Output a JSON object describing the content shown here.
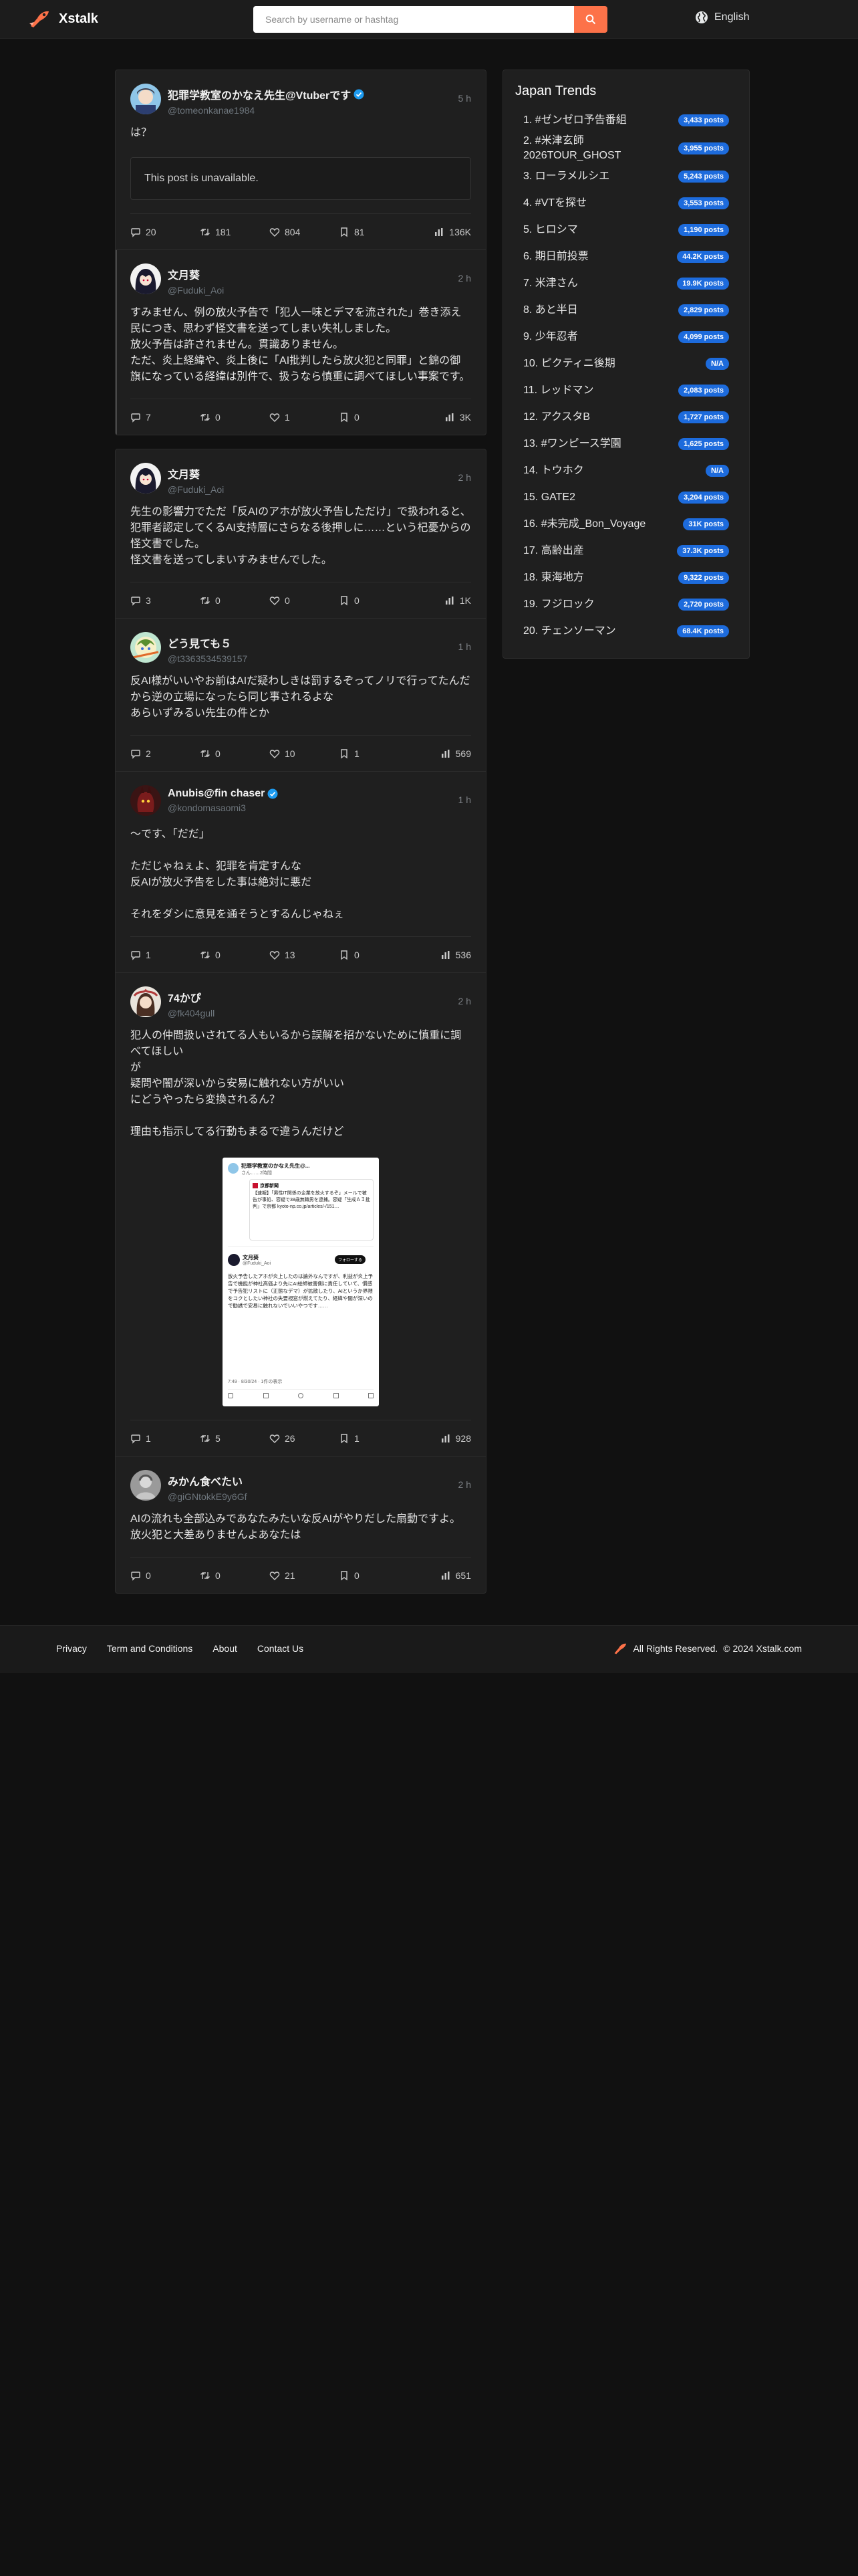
{
  "header": {
    "app_name": "Xstalk",
    "search_placeholder": "Search by username or hashtag",
    "language": "English",
    "brand_color": "#fd7249"
  },
  "posts": [
    {
      "display_name": "犯罪学教室のかなえ先生@Vtuberです",
      "username": "@tomeonkanae1984",
      "verified": true,
      "time": "5 h",
      "text": "は？",
      "unavailable": "This post is unavailable.",
      "stats": {
        "replies": "20",
        "reposts": "181",
        "likes": "804",
        "bookmarks": "81",
        "views": "136K"
      }
    },
    {
      "display_name": "文月葵",
      "username": "@Fuduki_Aoi",
      "verified": false,
      "time": "2 h",
      "text": "すみません、例の放火予告で「犯人一味とデマを流された」巻き添え民につき、思わず怪文書を送ってしまい失礼しました。\n放火予告は許されません。貫識ありません。\nただ、炎上経緯や、炎上後に「AI批判したら放火犯と同罪」と錦の御旗になっている経緯は別件で、扱うなら慎重に調べてほしい事案です。",
      "stats": {
        "replies": "7",
        "reposts": "0",
        "likes": "1",
        "bookmarks": "0",
        "views": "3K"
      }
    },
    {
      "display_name": "文月葵",
      "username": "@Fuduki_Aoi",
      "verified": false,
      "time": "2 h",
      "text": "先生の影響力でただ「反AIのアホが放火予告しただけ」で扱われると、犯罪者認定してくるAI支持層にさらなる後押しに……という杞憂からの怪文書でした。\n怪文書を送ってしまいすみませんでした。",
      "stats": {
        "replies": "3",
        "reposts": "0",
        "likes": "0",
        "bookmarks": "0",
        "views": "1K"
      }
    },
    {
      "display_name": "どう見ても５",
      "username": "@t3363534539157",
      "verified": false,
      "time": "1 h",
      "text": "反AI様がいいやお前はAIだ疑わしきは罰するぞってノリで行ってたんだから逆の立場になったら同じ事されるよな\nあらいずみるい先生の件とか",
      "stats": {
        "replies": "2",
        "reposts": "0",
        "likes": "10",
        "bookmarks": "1",
        "views": "569"
      }
    },
    {
      "display_name": "Anubis@fin chaser",
      "username": "@kondomasaomi3",
      "verified": true,
      "time": "1 h",
      "text": "〜です、「だだ」\n\nただじゃねぇよ、犯罪を肯定すんな\n反AIが放火予告をした事は絶対に悪だ\n\nそれをダシに意見を通そうとするんじゃねぇ",
      "stats": {
        "replies": "1",
        "reposts": "0",
        "likes": "13",
        "bookmarks": "0",
        "views": "536"
      }
    },
    {
      "display_name": "74かぴ",
      "username": "@fk404gull",
      "verified": false,
      "time": "2 h",
      "text": "犯人の仲間扱いされてる人もいるから誤解を招かないために慎重に調べてほしい\nが\n疑問や闇が深いから安易に触れない方がいい\nにどうやったら変換されるん？\n\n理由も指示してる行動もまるで違うんだけど",
      "embed": {
        "author": "犯罪学教室のかなえ先生@...",
        "handle": "さん……2時間",
        "quote_source": "京都新聞",
        "quote_text": "【速報】「男性IT関係の企業を放火するぞ」メールで被告が事処、容疑で38歳無職男を逮捕。容疑「生成ＡＩ批判」で京都 kyoto-np.co.jp/articles/-/151…",
        "reply_author": "文月葵",
        "reply_handle": "@Fuduki_Aoi",
        "follow_label": "フォローする",
        "reply_text": "放火予告したアホが炎上したのは論外なんですが、利益が炎上予告で機能が神社高価より先にAI絵師被害側に責任していて、慣感で予告犯リストに（正態なデマ）が拡散したり、AIというか界隈をコクとしたい神社の失要視窓が燃えてたり、経緯や闇が深いので勧誘で安易に触れないでいいやつです……",
        "footer_time": "7:49 · 8/30/24 · 1件の表示"
      },
      "stats": {
        "replies": "1",
        "reposts": "5",
        "likes": "26",
        "bookmarks": "1",
        "views": "928"
      }
    },
    {
      "display_name": "みかん食べたい",
      "username": "@giGNtokkE9y6Gf",
      "verified": false,
      "time": "2 h",
      "text": "AIの流れも全部込みであなたみたいな反AIがやりだした扇動ですよ。放火犯と大差ありませんよあなたは",
      "stats": {
        "replies": "0",
        "reposts": "0",
        "likes": "21",
        "bookmarks": "0",
        "views": "651"
      }
    }
  ],
  "trends": {
    "title": "Japan Trends",
    "items": [
      {
        "name": "1. #ゼンゼロ予告番組",
        "count": "3,433 posts"
      },
      {
        "name": "2. #米津玄師 2026TOUR_GHOST",
        "count": "3,955 posts"
      },
      {
        "name": "3. ローラメルシエ",
        "count": "5,243 posts"
      },
      {
        "name": "4. #VTを探せ",
        "count": "3,553 posts"
      },
      {
        "name": "5. ヒロシマ",
        "count": "1,190 posts"
      },
      {
        "name": "6. 期日前投票",
        "count": "44.2K posts"
      },
      {
        "name": "7. 米津さん",
        "count": "19.9K posts"
      },
      {
        "name": "8. あと半日",
        "count": "2,829 posts"
      },
      {
        "name": "9. 少年忍者",
        "count": "4,099 posts"
      },
      {
        "name": "10. ピクティニ後期",
        "count": "N/A"
      },
      {
        "name": "11. レッドマン",
        "count": "2,083 posts"
      },
      {
        "name": "12. アクスタB",
        "count": "1,727 posts"
      },
      {
        "name": "13. #ワンピース学園",
        "count": "1,625 posts"
      },
      {
        "name": "14. トウホク",
        "count": "N/A"
      },
      {
        "name": "15. GATE2",
        "count": "3,204 posts"
      },
      {
        "name": "16. #未完成_Bon_Voyage",
        "count": "31K posts"
      },
      {
        "name": "17. 高齢出産",
        "count": "37.3K posts"
      },
      {
        "name": "18. 東海地方",
        "count": "9,322 posts"
      },
      {
        "name": "19. フジロック",
        "count": "2,720 posts"
      },
      {
        "name": "20. チェンソーマン",
        "count": "68.4K posts"
      }
    ]
  },
  "footer": {
    "links": [
      "Privacy",
      "Term and Conditions",
      "About",
      "Contact Us"
    ],
    "rights": "All Rights Reserved.",
    "copyright": "© 2024 Xstalk.com"
  }
}
